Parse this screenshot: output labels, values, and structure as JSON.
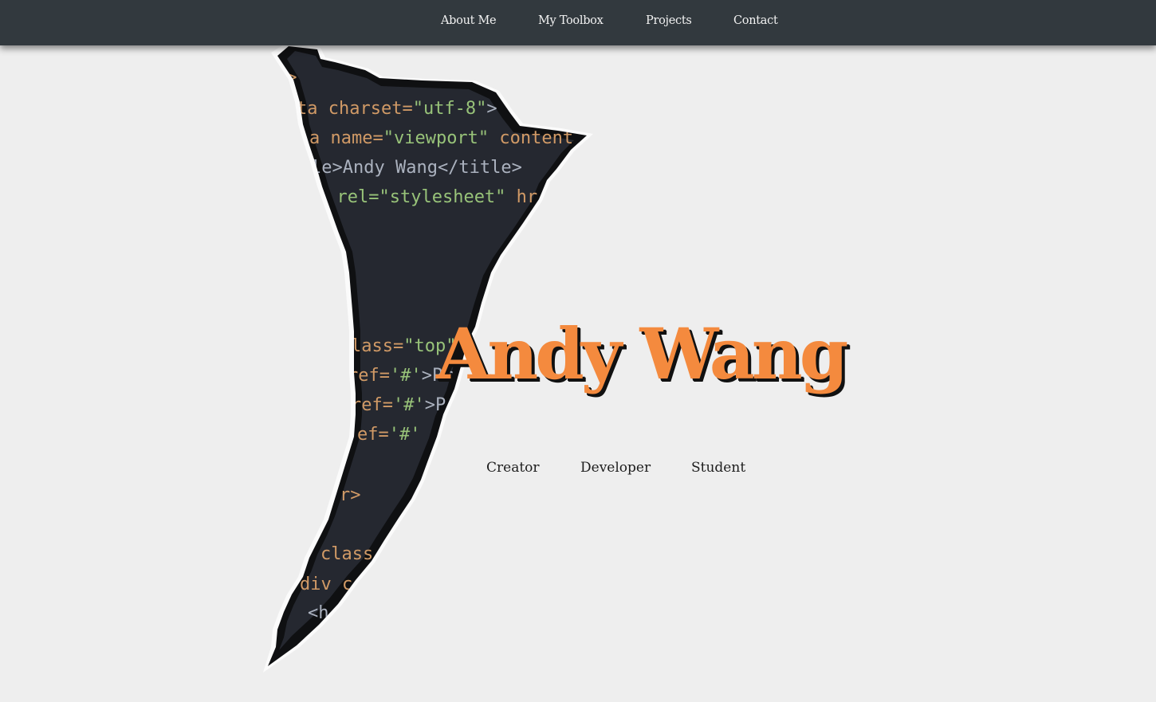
{
  "nav": {
    "items": [
      {
        "label": "About Me"
      },
      {
        "label": "My Toolbox"
      },
      {
        "label": "Projects"
      },
      {
        "label": "Contact"
      }
    ]
  },
  "background_code": {
    "lines": [
      [
        "d>"
      ],
      [
        "ta charset=",
        "\"utf-8\"",
        ">"
      ],
      [
        "a name=",
        "\"viewport\"",
        " content"
      ],
      [
        "le>Andy Wang</title>"
      ],
      [
        "' rel=",
        "\"stylesheet\"",
        " hr"
      ],
      [
        "lass=",
        "\"top\""
      ],
      [
        "ref=",
        "'#'",
        ">Pr"
      ],
      [
        "ref=",
        "'#'",
        ">P"
      ],
      [
        "ef=",
        "'#'"
      ],
      [
        "r>"
      ],
      [
        "class"
      ],
      [
        "div c"
      ],
      [
        "<h"
      ]
    ]
  },
  "hero": {
    "name": "Andy Wang",
    "roles": [
      "Creator",
      "Developer",
      "Student"
    ]
  },
  "colors": {
    "navbar": "#32393e",
    "page_background": "#eeeeee",
    "name_orange": "#f48a3e",
    "code_background": "#252830"
  }
}
